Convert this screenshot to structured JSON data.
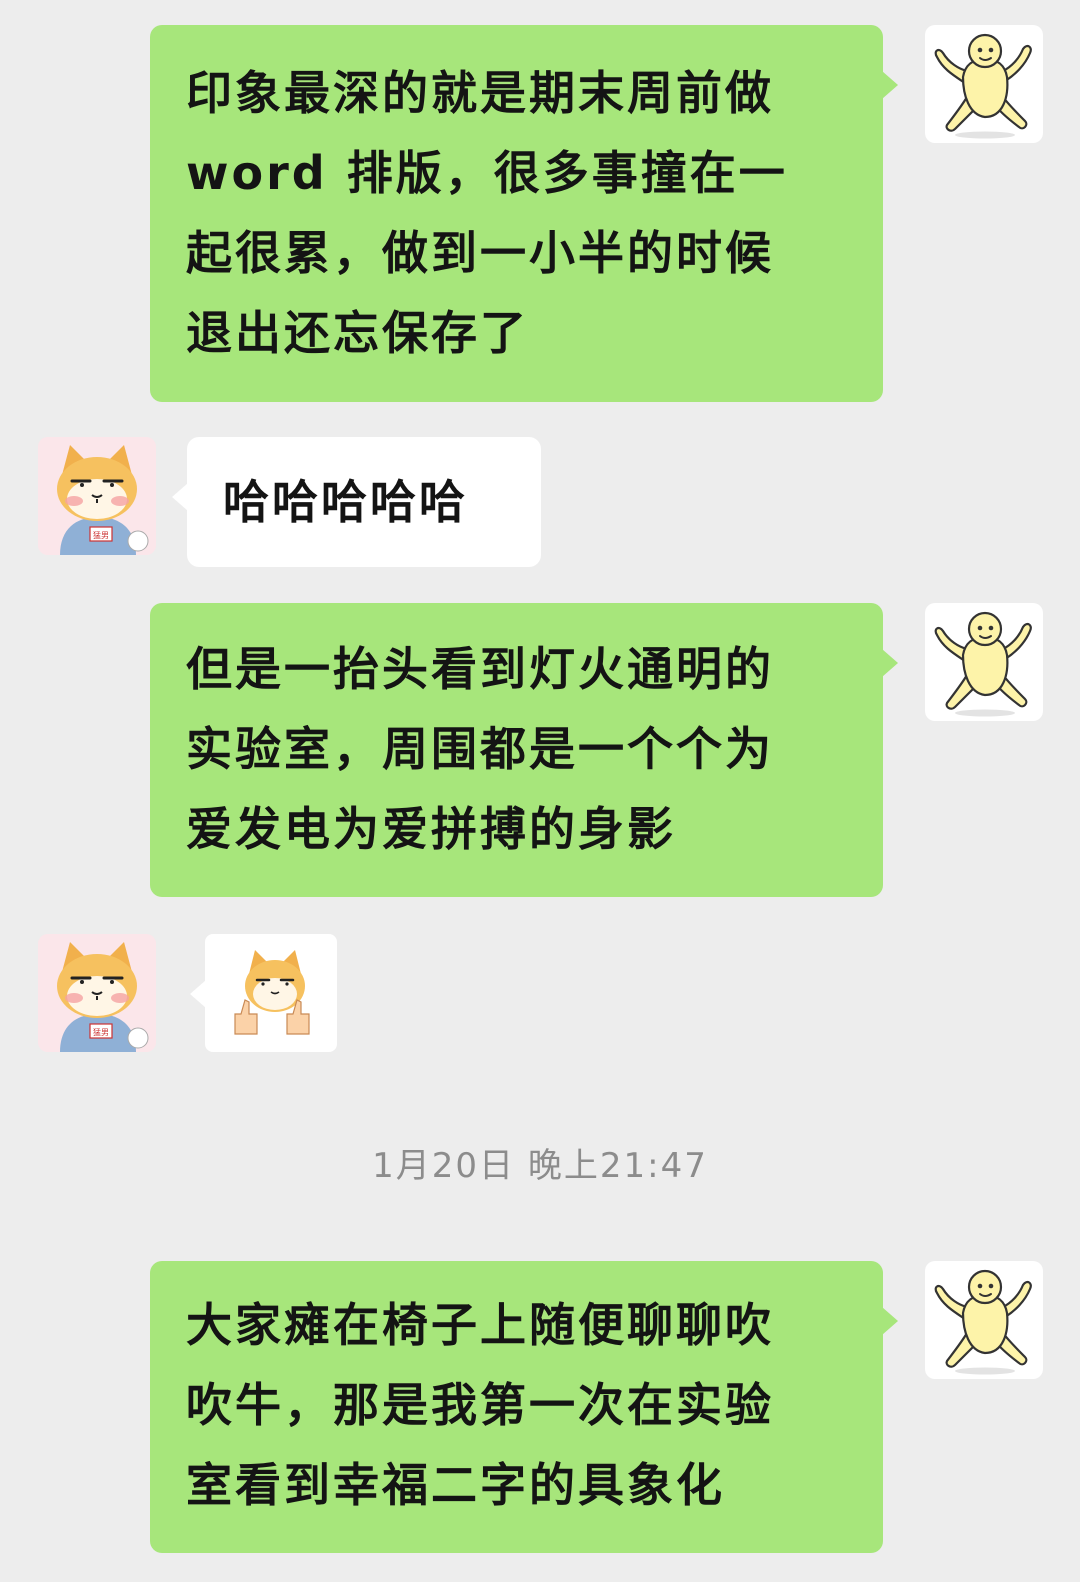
{
  "messages": [
    {
      "side": "right",
      "lines": [
        "印象最深的就是期末周前做",
        "word 排版，很多事撞在一",
        "起很累，做到一小半的时候",
        "退出还忘保存了"
      ]
    },
    {
      "side": "left",
      "lines": [
        "哈哈哈哈哈"
      ]
    },
    {
      "side": "right",
      "lines": [
        "但是一抬头看到灯火通明的",
        "实验室，周围都是一个个为",
        "爱发电为爱拼搏的身影"
      ]
    },
    {
      "side": "left",
      "type": "sticker",
      "sticker": "shiba-thumbs-up-sticker"
    },
    {
      "side": "right",
      "lines": [
        "大家瘫在椅子上随便聊聊吹",
        "吹牛，那是我第一次在实验",
        "室看到幸福二字的具象化"
      ]
    }
  ],
  "timestamp": "1月20日 晚上21:47",
  "avatars": {
    "self": "yellow-blob-avatar-icon",
    "other": "shiba-dog-avatar-icon",
    "other_shirt_text": "猛男"
  },
  "colors": {
    "background": "#ededed",
    "self_bubble": "#a7e67b",
    "other_bubble": "#ffffff",
    "timestamp": "#8c8c8c"
  }
}
